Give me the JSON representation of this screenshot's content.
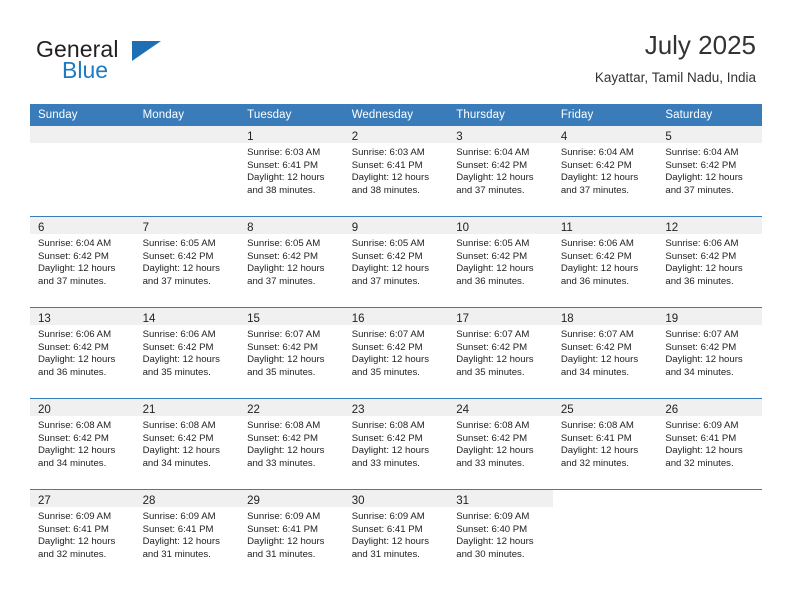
{
  "brand": {
    "name_part1": "General",
    "name_part2": "Blue",
    "flag_icon": "triangle-flag-icon"
  },
  "header": {
    "title": "July 2025",
    "subtitle": "Kayattar, Tamil Nadu, India"
  },
  "calendar": {
    "accent_color": "#3a7cba",
    "daynum_band_color": "#f0f0f0",
    "weekday_headers": [
      "Sunday",
      "Monday",
      "Tuesday",
      "Wednesday",
      "Thursday",
      "Friday",
      "Saturday"
    ],
    "weeks": [
      [
        {
          "day": "",
          "sunrise": "",
          "sunset": "",
          "daylight_line1": "",
          "daylight_line2": "",
          "empty": true
        },
        {
          "day": "",
          "sunrise": "",
          "sunset": "",
          "daylight_line1": "",
          "daylight_line2": "",
          "empty": true
        },
        {
          "day": "1",
          "sunrise": "Sunrise: 6:03 AM",
          "sunset": "Sunset: 6:41 PM",
          "daylight_line1": "Daylight: 12 hours",
          "daylight_line2": "and 38 minutes."
        },
        {
          "day": "2",
          "sunrise": "Sunrise: 6:03 AM",
          "sunset": "Sunset: 6:41 PM",
          "daylight_line1": "Daylight: 12 hours",
          "daylight_line2": "and 38 minutes."
        },
        {
          "day": "3",
          "sunrise": "Sunrise: 6:04 AM",
          "sunset": "Sunset: 6:42 PM",
          "daylight_line1": "Daylight: 12 hours",
          "daylight_line2": "and 37 minutes."
        },
        {
          "day": "4",
          "sunrise": "Sunrise: 6:04 AM",
          "sunset": "Sunset: 6:42 PM",
          "daylight_line1": "Daylight: 12 hours",
          "daylight_line2": "and 37 minutes."
        },
        {
          "day": "5",
          "sunrise": "Sunrise: 6:04 AM",
          "sunset": "Sunset: 6:42 PM",
          "daylight_line1": "Daylight: 12 hours",
          "daylight_line2": "and 37 minutes."
        }
      ],
      [
        {
          "day": "6",
          "sunrise": "Sunrise: 6:04 AM",
          "sunset": "Sunset: 6:42 PM",
          "daylight_line1": "Daylight: 12 hours",
          "daylight_line2": "and 37 minutes."
        },
        {
          "day": "7",
          "sunrise": "Sunrise: 6:05 AM",
          "sunset": "Sunset: 6:42 PM",
          "daylight_line1": "Daylight: 12 hours",
          "daylight_line2": "and 37 minutes."
        },
        {
          "day": "8",
          "sunrise": "Sunrise: 6:05 AM",
          "sunset": "Sunset: 6:42 PM",
          "daylight_line1": "Daylight: 12 hours",
          "daylight_line2": "and 37 minutes."
        },
        {
          "day": "9",
          "sunrise": "Sunrise: 6:05 AM",
          "sunset": "Sunset: 6:42 PM",
          "daylight_line1": "Daylight: 12 hours",
          "daylight_line2": "and 37 minutes."
        },
        {
          "day": "10",
          "sunrise": "Sunrise: 6:05 AM",
          "sunset": "Sunset: 6:42 PM",
          "daylight_line1": "Daylight: 12 hours",
          "daylight_line2": "and 36 minutes."
        },
        {
          "day": "11",
          "sunrise": "Sunrise: 6:06 AM",
          "sunset": "Sunset: 6:42 PM",
          "daylight_line1": "Daylight: 12 hours",
          "daylight_line2": "and 36 minutes."
        },
        {
          "day": "12",
          "sunrise": "Sunrise: 6:06 AM",
          "sunset": "Sunset: 6:42 PM",
          "daylight_line1": "Daylight: 12 hours",
          "daylight_line2": "and 36 minutes."
        }
      ],
      [
        {
          "day": "13",
          "sunrise": "Sunrise: 6:06 AM",
          "sunset": "Sunset: 6:42 PM",
          "daylight_line1": "Daylight: 12 hours",
          "daylight_line2": "and 36 minutes."
        },
        {
          "day": "14",
          "sunrise": "Sunrise: 6:06 AM",
          "sunset": "Sunset: 6:42 PM",
          "daylight_line1": "Daylight: 12 hours",
          "daylight_line2": "and 35 minutes."
        },
        {
          "day": "15",
          "sunrise": "Sunrise: 6:07 AM",
          "sunset": "Sunset: 6:42 PM",
          "daylight_line1": "Daylight: 12 hours",
          "daylight_line2": "and 35 minutes."
        },
        {
          "day": "16",
          "sunrise": "Sunrise: 6:07 AM",
          "sunset": "Sunset: 6:42 PM",
          "daylight_line1": "Daylight: 12 hours",
          "daylight_line2": "and 35 minutes."
        },
        {
          "day": "17",
          "sunrise": "Sunrise: 6:07 AM",
          "sunset": "Sunset: 6:42 PM",
          "daylight_line1": "Daylight: 12 hours",
          "daylight_line2": "and 35 minutes."
        },
        {
          "day": "18",
          "sunrise": "Sunrise: 6:07 AM",
          "sunset": "Sunset: 6:42 PM",
          "daylight_line1": "Daylight: 12 hours",
          "daylight_line2": "and 34 minutes."
        },
        {
          "day": "19",
          "sunrise": "Sunrise: 6:07 AM",
          "sunset": "Sunset: 6:42 PM",
          "daylight_line1": "Daylight: 12 hours",
          "daylight_line2": "and 34 minutes."
        }
      ],
      [
        {
          "day": "20",
          "sunrise": "Sunrise: 6:08 AM",
          "sunset": "Sunset: 6:42 PM",
          "daylight_line1": "Daylight: 12 hours",
          "daylight_line2": "and 34 minutes."
        },
        {
          "day": "21",
          "sunrise": "Sunrise: 6:08 AM",
          "sunset": "Sunset: 6:42 PM",
          "daylight_line1": "Daylight: 12 hours",
          "daylight_line2": "and 34 minutes."
        },
        {
          "day": "22",
          "sunrise": "Sunrise: 6:08 AM",
          "sunset": "Sunset: 6:42 PM",
          "daylight_line1": "Daylight: 12 hours",
          "daylight_line2": "and 33 minutes."
        },
        {
          "day": "23",
          "sunrise": "Sunrise: 6:08 AM",
          "sunset": "Sunset: 6:42 PM",
          "daylight_line1": "Daylight: 12 hours",
          "daylight_line2": "and 33 minutes."
        },
        {
          "day": "24",
          "sunrise": "Sunrise: 6:08 AM",
          "sunset": "Sunset: 6:42 PM",
          "daylight_line1": "Daylight: 12 hours",
          "daylight_line2": "and 33 minutes."
        },
        {
          "day": "25",
          "sunrise": "Sunrise: 6:08 AM",
          "sunset": "Sunset: 6:41 PM",
          "daylight_line1": "Daylight: 12 hours",
          "daylight_line2": "and 32 minutes."
        },
        {
          "day": "26",
          "sunrise": "Sunrise: 6:09 AM",
          "sunset": "Sunset: 6:41 PM",
          "daylight_line1": "Daylight: 12 hours",
          "daylight_line2": "and 32 minutes."
        }
      ],
      [
        {
          "day": "27",
          "sunrise": "Sunrise: 6:09 AM",
          "sunset": "Sunset: 6:41 PM",
          "daylight_line1": "Daylight: 12 hours",
          "daylight_line2": "and 32 minutes."
        },
        {
          "day": "28",
          "sunrise": "Sunrise: 6:09 AM",
          "sunset": "Sunset: 6:41 PM",
          "daylight_line1": "Daylight: 12 hours",
          "daylight_line2": "and 31 minutes."
        },
        {
          "day": "29",
          "sunrise": "Sunrise: 6:09 AM",
          "sunset": "Sunset: 6:41 PM",
          "daylight_line1": "Daylight: 12 hours",
          "daylight_line2": "and 31 minutes."
        },
        {
          "day": "30",
          "sunrise": "Sunrise: 6:09 AM",
          "sunset": "Sunset: 6:41 PM",
          "daylight_line1": "Daylight: 12 hours",
          "daylight_line2": "and 31 minutes."
        },
        {
          "day": "31",
          "sunrise": "Sunrise: 6:09 AM",
          "sunset": "Sunset: 6:40 PM",
          "daylight_line1": "Daylight: 12 hours",
          "daylight_line2": "and 30 minutes."
        },
        {
          "day": "",
          "sunrise": "",
          "sunset": "",
          "daylight_line1": "",
          "daylight_line2": "",
          "empty": true,
          "blank": true
        },
        {
          "day": "",
          "sunrise": "",
          "sunset": "",
          "daylight_line1": "",
          "daylight_line2": "",
          "empty": true,
          "blank": true
        }
      ]
    ]
  }
}
